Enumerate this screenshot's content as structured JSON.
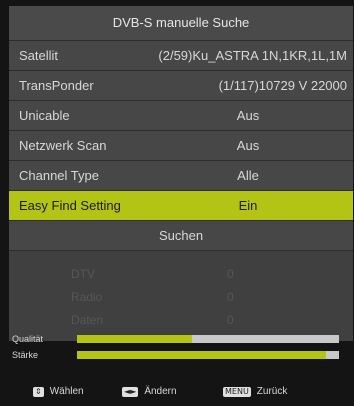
{
  "menu": {
    "title": "DVB-S manuelle Suche",
    "rows": [
      {
        "label": "Satellit",
        "value": "(2/59)Ku_ASTRA 1N,1KR,1L,1M"
      },
      {
        "label": "TransPonder",
        "value": "(1/117)10729 V 22000"
      },
      {
        "label": "Unicable",
        "value": "Aus"
      },
      {
        "label": "Netzwerk Scan",
        "value": "Aus"
      },
      {
        "label": "Channel Type",
        "value": "Alle"
      },
      {
        "label": "Easy Find Setting",
        "value": "Ein",
        "selected": true
      }
    ],
    "search_label": "Suchen",
    "status": [
      {
        "label": "DTV",
        "value": "0"
      },
      {
        "label": "Radio",
        "value": "0"
      },
      {
        "label": "Daten",
        "value": "0"
      }
    ]
  },
  "signal": {
    "quality": {
      "label": "Qualität",
      "level_percent": 44
    },
    "strength": {
      "label": "Stärke",
      "level_percent": 95
    }
  },
  "footer": {
    "select": {
      "key": "⇕",
      "label": "Wählen"
    },
    "change": {
      "key": "◄►",
      "label": "Ändern"
    },
    "back": {
      "key": "MENU",
      "label": "Zurück"
    }
  },
  "colors": {
    "highlight": "#b4c415",
    "panel": "#474747"
  }
}
